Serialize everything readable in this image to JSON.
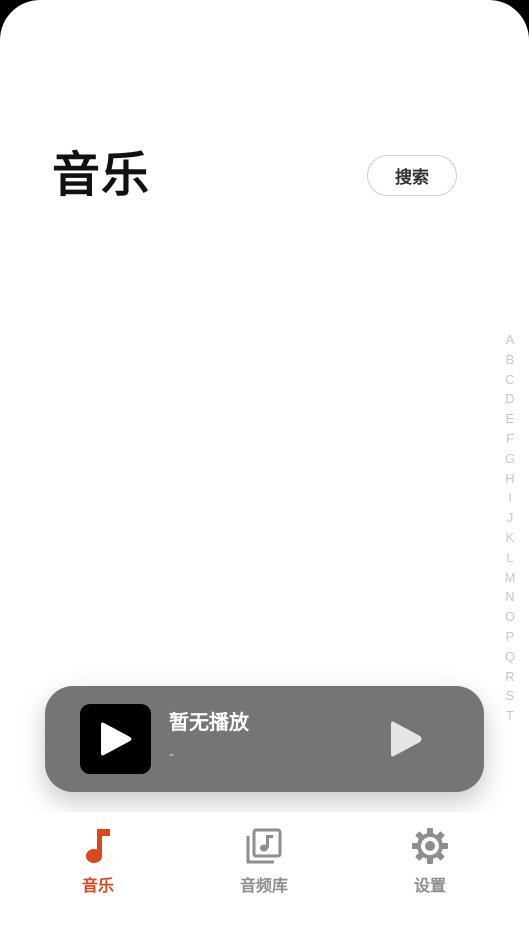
{
  "header": {
    "title": "音乐",
    "search_label": "搜索"
  },
  "alpha_index": [
    "A",
    "B",
    "C",
    "D",
    "E",
    "F",
    "G",
    "H",
    "I",
    "J",
    "K",
    "L",
    "M",
    "N",
    "O",
    "P",
    "Q",
    "R",
    "S",
    "T"
  ],
  "player": {
    "title": "暂无播放",
    "artist": "-",
    "cover_icon": "play-icon",
    "play_icon": "play-icon"
  },
  "tabs": [
    {
      "label": "音乐",
      "icon": "music-note-icon",
      "active": true
    },
    {
      "label": "音频库",
      "icon": "music-library-icon",
      "active": false
    },
    {
      "label": "设置",
      "icon": "gear-icon",
      "active": false
    }
  ],
  "colors": {
    "accent": "#D9471C",
    "inactive": "#8E8E8E",
    "player_bg": "#757575"
  }
}
